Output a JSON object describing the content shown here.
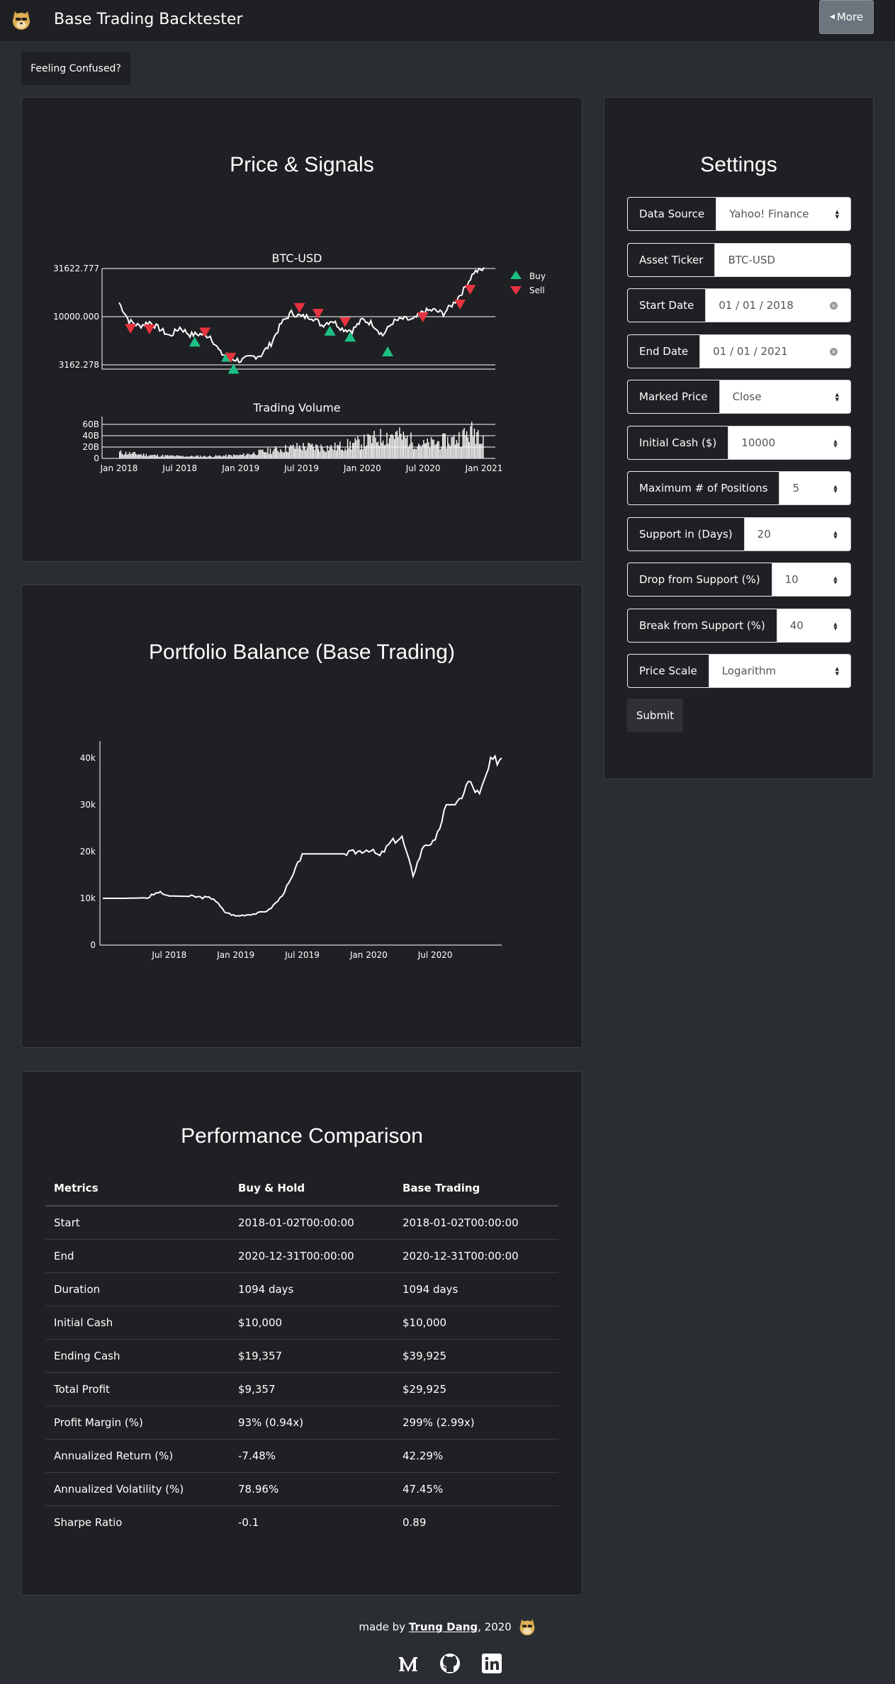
{
  "nav": {
    "brand": "Base Trading Backtester",
    "more_label": "More"
  },
  "help_button": "Feeling Confused?",
  "price_chart": {
    "title": "Price & Signals",
    "chart_data": [
      {
        "type": "line",
        "title": "BTC-USD",
        "y_scale": "log",
        "y_ticks": [
          "31622.777",
          "10000.000",
          "3162.278"
        ],
        "legend": [
          "Buy",
          "Sell"
        ],
        "legend_placement": "top-right",
        "x": [
          "2018-01",
          "2018-02",
          "2018-03",
          "2018-04",
          "2018-05",
          "2018-06",
          "2018-07",
          "2018-08",
          "2018-09",
          "2018-10",
          "2018-11",
          "2018-12",
          "2019-01",
          "2019-02",
          "2019-03",
          "2019-04",
          "2019-05",
          "2019-06",
          "2019-07",
          "2019-08",
          "2019-09",
          "2019-10",
          "2019-11",
          "2019-12",
          "2020-01",
          "2020-02",
          "2020-03",
          "2020-04",
          "2020-05",
          "2020-06",
          "2020-07",
          "2020-08",
          "2020-09",
          "2020-10",
          "2020-11",
          "2020-12",
          "2021-01"
        ],
        "values": [
          14000,
          9000,
          8000,
          8800,
          7500,
          6300,
          7700,
          6500,
          6600,
          6300,
          4200,
          3700,
          3500,
          3800,
          4000,
          5300,
          8500,
          11000,
          10000,
          10000,
          8200,
          9200,
          7500,
          7200,
          9300,
          8500,
          6400,
          8800,
          9500,
          9200,
          11300,
          11700,
          10800,
          13800,
          19000,
          29000,
          31000
        ],
        "buy_signals": [
          [
            "2018-08-15",
            6300
          ],
          [
            "2018-11-20",
            4400
          ],
          [
            "2018-12-10",
            3300
          ],
          [
            "2019-09-25",
            8200
          ],
          [
            "2019-11-25",
            7100
          ],
          [
            "2020-03-16",
            5000
          ]
        ],
        "sell_signals": [
          [
            "2018-02-05",
            7000
          ],
          [
            "2018-04-01",
            6900
          ],
          [
            "2018-09-15",
            6400
          ],
          [
            "2018-12-01",
            3500
          ],
          [
            "2019-06-25",
            11500
          ],
          [
            "2019-08-20",
            10000
          ],
          [
            "2019-11-10",
            8200
          ],
          [
            "2020-06-30",
            9200
          ],
          [
            "2020-10-20",
            12500
          ],
          [
            "2020-11-20",
            17800
          ]
        ],
        "ylim": [
          3000,
          34000
        ]
      },
      {
        "type": "bar",
        "title": "Trading Volume",
        "y_ticks": [
          "60B",
          "40B",
          "20B",
          "0"
        ],
        "x_ticks": [
          "Jan 2018",
          "Jul 2018",
          "Jan 2019",
          "Jul 2019",
          "Jan 2020",
          "Jul 2020",
          "Jan 2021"
        ],
        "x": [
          "2018-01",
          "2018-04",
          "2018-07",
          "2018-10",
          "2019-01",
          "2019-04",
          "2019-07",
          "2019-10",
          "2020-01",
          "2020-04",
          "2020-07",
          "2020-10",
          "2020-12"
        ],
        "values": [
          11,
          6,
          4,
          4,
          6,
          15,
          22,
          20,
          30,
          45,
          25,
          35,
          50
        ],
        "unit": "B",
        "ylim": [
          0,
          70
        ]
      }
    ]
  },
  "portfolio_chart": {
    "title": "Portfolio Balance (Base Trading)",
    "chart_data": {
      "type": "line",
      "y_ticks": [
        "40k",
        "30k",
        "20k",
        "10k",
        "0"
      ],
      "x_ticks": [
        "Jul 2018",
        "Jan 2019",
        "Jul 2019",
        "Jan 2020",
        "Jul 2020"
      ],
      "x": [
        "2018-01",
        "2018-03",
        "2018-05",
        "2018-06",
        "2018-07",
        "2018-09",
        "2018-11",
        "2018-12",
        "2019-01",
        "2019-02",
        "2019-03",
        "2019-04",
        "2019-05",
        "2019-06",
        "2019-07",
        "2019-09",
        "2019-11",
        "2020-01",
        "2020-02",
        "2020-03",
        "2020-04",
        "2020-05",
        "2020-06",
        "2020-07",
        "2020-08",
        "2020-09",
        "2020-10",
        "2020-11",
        "2020-12",
        "2021-01"
      ],
      "values": [
        10000,
        10000,
        10100,
        11300,
        10500,
        10400,
        10000,
        7100,
        6200,
        6500,
        6800,
        7500,
        10000,
        14000,
        19500,
        19500,
        19500,
        20500,
        19000,
        22000,
        23000,
        15000,
        21500,
        22000,
        30000,
        30000,
        35000,
        32000,
        39000,
        40000
      ],
      "ylim": [
        0,
        42000
      ]
    }
  },
  "settings": {
    "title": "Settings",
    "fields": [
      {
        "label": "Data Source",
        "value": "Yahoo! Finance",
        "kind": "select"
      },
      {
        "label": "Asset Ticker",
        "value": "BTC-USD",
        "kind": "text"
      },
      {
        "label": "Start Date",
        "value": "01 / 01 / 2018",
        "kind": "date"
      },
      {
        "label": "End Date",
        "value": "01 / 01 / 2021",
        "kind": "date"
      },
      {
        "label": "Marked Price",
        "value": "Close",
        "kind": "select"
      },
      {
        "label": "Initial Cash ($)",
        "value": "10000",
        "kind": "number"
      },
      {
        "label": "Maximum # of Positions",
        "value": "5",
        "kind": "number"
      },
      {
        "label": "Support in (Days)",
        "value": "20",
        "kind": "number"
      },
      {
        "label": "Drop from Support (%)",
        "value": "10",
        "kind": "number"
      },
      {
        "label": "Break from Support (%)",
        "value": "40",
        "kind": "number"
      },
      {
        "label": "Price Scale",
        "value": "Logarithm",
        "kind": "select"
      }
    ],
    "submit_label": "Submit"
  },
  "performance": {
    "title": "Performance Comparison",
    "headers": [
      "Metrics",
      "Buy & Hold",
      "Base Trading"
    ],
    "rows": [
      [
        "Start",
        "2018-01-02T00:00:00",
        "2018-01-02T00:00:00"
      ],
      [
        "End",
        "2020-12-31T00:00:00",
        "2020-12-31T00:00:00"
      ],
      [
        "Duration",
        "1094 days",
        "1094 days"
      ],
      [
        "Initial Cash",
        "$10,000",
        "$10,000"
      ],
      [
        "Ending Cash",
        "$19,357",
        "$39,925"
      ],
      [
        "Total Profit",
        "$9,357",
        "$29,925"
      ],
      [
        "Profit Margin (%)",
        "93% (0.94x)",
        "299% (2.99x)"
      ],
      [
        "Annualized Return (%)",
        "-7.48%",
        "42.29%"
      ],
      [
        "Annualized Volatility (%)",
        "78.96%",
        "47.45%"
      ],
      [
        "Sharpe Ratio",
        "-0.1",
        "0.89"
      ]
    ]
  },
  "footer": {
    "prefix": "made by ",
    "author": "Trung Dang",
    "suffix": ", 2020"
  },
  "icons": {
    "logo": "doge-face-icon",
    "social": [
      "medium-icon",
      "github-icon",
      "linkedin-icon"
    ]
  }
}
